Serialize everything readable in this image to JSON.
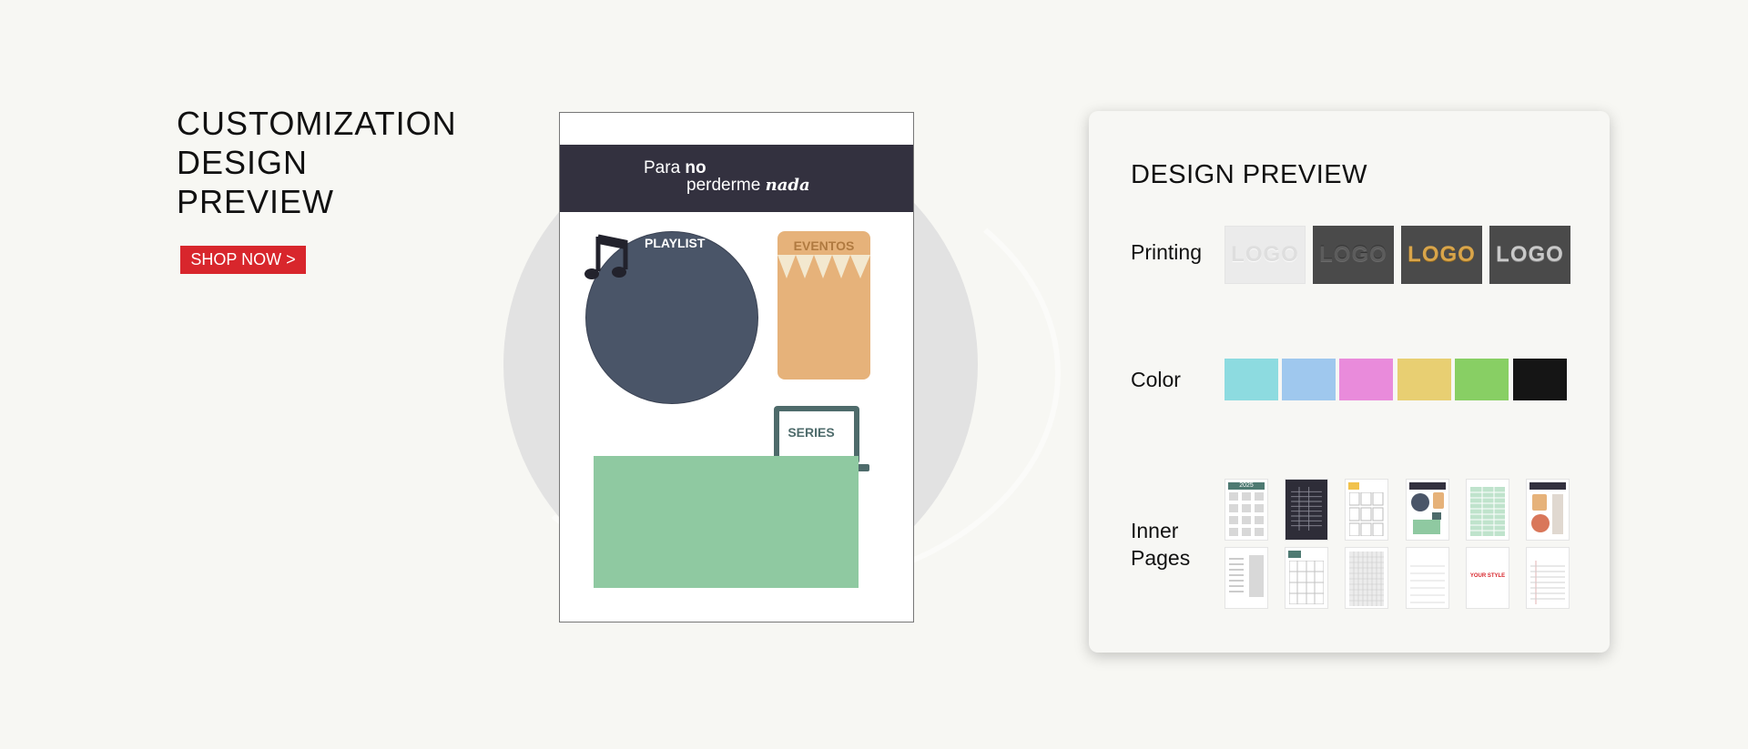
{
  "hero": {
    "title_lines": [
      "CUSTOMIZATION",
      "DESIGN",
      "PREVIEW"
    ],
    "shop_button": "SHOP NOW >"
  },
  "page_preview": {
    "header_line1_a": "Para ",
    "header_line1_b": "no",
    "header_line2_a": "perderme ",
    "header_line2_b": "nada",
    "playlist": "PLAYLIST",
    "eventos": "EVENTOS",
    "series": "SERIES"
  },
  "design_preview": {
    "title": "DESIGN PREVIEW",
    "printing_label": "Printing",
    "color_label": "Color",
    "inner_pages_label_1": "Inner",
    "inner_pages_label_2": "Pages",
    "logo_text": "LOGO",
    "colors": [
      "#8ddbe0",
      "#9fc8ee",
      "#e98bdb",
      "#e8cf72",
      "#88cf64",
      "#151515"
    ],
    "thumb_year": "2025",
    "thumb_style": "YOUR STYLE"
  },
  "icons": {
    "music_note": "music-note-icon",
    "laptop": "laptop-icon",
    "bunting": "bunting-icon"
  }
}
